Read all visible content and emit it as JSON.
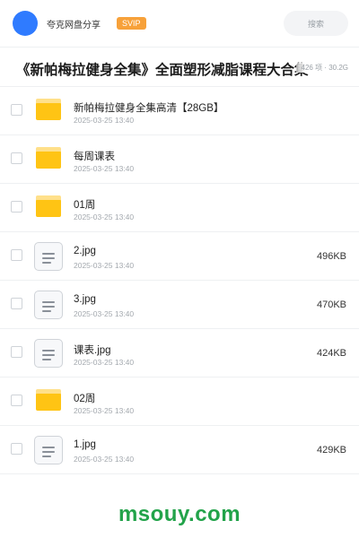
{
  "header": {
    "user_name": "夸克网盘分享",
    "badge": "SVIP",
    "search_label": "搜索",
    "avatar_color": "#2f7bff"
  },
  "title": {
    "text": "《新帕梅拉健身全集》全面塑形减脂课程大合集",
    "meta": "426 项 · 30.2G"
  },
  "files": [
    {
      "type": "folder",
      "name": "新帕梅拉健身全集高清【28GB】",
      "date": "2025-03-25 13:40",
      "size": ""
    },
    {
      "type": "folder",
      "name": "每周课表",
      "date": "2025-03-25 13:40",
      "size": ""
    },
    {
      "type": "folder",
      "name": "01周",
      "date": "2025-03-25 13:40",
      "size": ""
    },
    {
      "type": "file",
      "name": "2.jpg",
      "date": "2025-03-25 13:40",
      "size": "496KB"
    },
    {
      "type": "file",
      "name": "3.jpg",
      "date": "2025-03-25 13:40",
      "size": "470KB"
    },
    {
      "type": "file",
      "name": "课表.jpg",
      "date": "2025-03-25 13:40",
      "size": "424KB"
    },
    {
      "type": "folder",
      "name": "02周",
      "date": "2025-03-25 13:40",
      "size": ""
    },
    {
      "type": "file",
      "name": "1.jpg",
      "date": "2025-03-25 13:40",
      "size": "429KB"
    }
  ],
  "watermark": "msouy.com",
  "colors": {
    "accent": "#2f7bff",
    "badge": "#f7a13a",
    "folder": "#ffc414",
    "watermark": "#22a34a"
  }
}
